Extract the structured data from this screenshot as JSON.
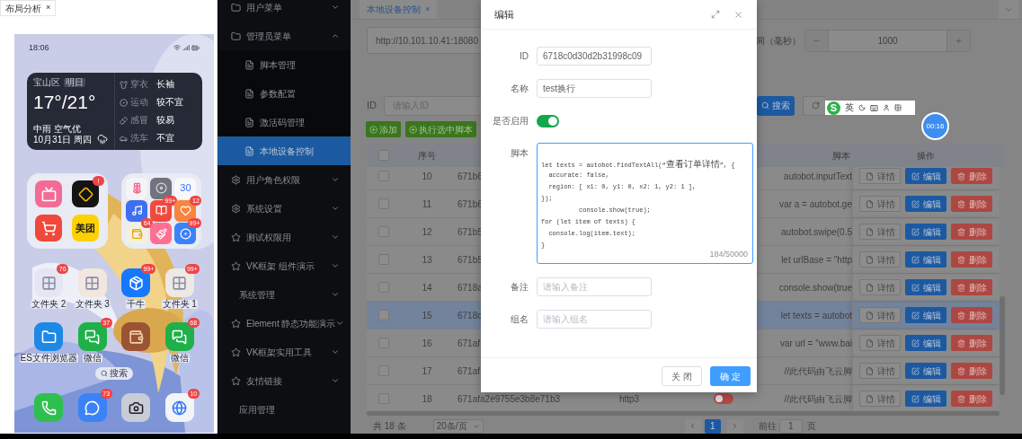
{
  "phone_panel": {
    "tab": {
      "label": "布局分析",
      "close": "×"
    },
    "time": "18:06",
    "weather": {
      "district": "宝山区",
      "day": "明日",
      "temperature": "17°/21°",
      "condition": "中雨 空气优",
      "date": "10月31日 周四",
      "indices": [
        {
          "kind": "clothes",
          "label": "穿衣",
          "value": "长袖"
        },
        {
          "kind": "sport",
          "label": "运动",
          "value": "较不宜"
        },
        {
          "kind": "cold",
          "label": "感冒",
          "value": "较易"
        },
        {
          "kind": "carwash",
          "label": "洗车",
          "value": "不宜"
        }
      ]
    },
    "folder_cards": [
      {
        "apps": [
          {
            "kind": "tv",
            "color": "#f46b96"
          },
          {
            "kind": "diamond",
            "color": "#141414",
            "badge": "!"
          },
          {
            "kind": "cart",
            "color": "#f0483a"
          },
          {
            "kind": "text",
            "color": "#ffd100",
            "text": "美团"
          }
        ]
      },
      {
        "apps": [
          {
            "kind": "flower",
            "color": "#f4f4f6"
          },
          {
            "kind": "wheel",
            "color": "#70747e"
          },
          {
            "kind": "calendar",
            "color": "#f8f8fa",
            "text": "30"
          },
          {
            "kind": "music",
            "color": "#3d6ff0"
          },
          {
            "kind": "book",
            "color": "#ee4b3e",
            "badge": "99+"
          },
          {
            "kind": "heart",
            "color": "#f8843d",
            "badge": "12"
          },
          {
            "kind": "wallet",
            "color": "#f4f0e0",
            "badge": "64"
          },
          {
            "kind": "brush",
            "color": "#ff6f91"
          },
          {
            "kind": "circle",
            "color": "#3b82f6",
            "badge": "99+"
          }
        ]
      }
    ],
    "home_rows": [
      [
        {
          "kind": "folder",
          "color": "#e4e7f3",
          "badge": "76",
          "label": "文件夹 2"
        },
        {
          "kind": "folder",
          "color": "#f1e7df",
          "label": "文件夹 3"
        },
        {
          "kind": "app",
          "color": "#1677ff",
          "badge": "99+",
          "label": "千牛"
        },
        {
          "kind": "folder",
          "color": "#eee9e4",
          "badge": "99+",
          "label": "文件夹 1"
        }
      ],
      [
        {
          "kind": "files",
          "color": "#1e88e5",
          "label": "ES文件浏览器"
        },
        {
          "kind": "chat",
          "color": "#1fb04a",
          "badge": "37",
          "label": "微信"
        },
        {
          "kind": "pouch",
          "color": "#9a5434"
        },
        {
          "kind": "chat",
          "color": "#1fb04a",
          "badge": "68",
          "label": "微信"
        }
      ]
    ],
    "search": "搜索",
    "dock": [
      {
        "kind": "phone",
        "color": "#2fbf4f"
      },
      {
        "kind": "message",
        "color": "#3b82f6",
        "badge": "73"
      },
      {
        "kind": "camera",
        "color": "#c9ccd6"
      },
      {
        "kind": "globe",
        "color": "#f2f4f8",
        "badge": "10"
      }
    ]
  },
  "sidebar": {
    "items": [
      {
        "kind": "folder",
        "label": "用户菜单",
        "expanded": false,
        "selected": false
      },
      {
        "kind": "folder",
        "label": "管理员菜单",
        "expanded": true,
        "selected": false,
        "children": [
          {
            "kind": "file",
            "label": "脚本管理",
            "selected": false
          },
          {
            "kind": "file",
            "label": "参数配置",
            "selected": false
          },
          {
            "kind": "file",
            "label": "激活码管理",
            "selected": false
          },
          {
            "kind": "file",
            "label": "本地设备控制",
            "selected": true
          }
        ]
      },
      {
        "kind": "gear",
        "label": "用户角色权限",
        "expanded": false,
        "selected": false
      },
      {
        "kind": "gear",
        "label": "系统设置",
        "expanded": false,
        "selected": false
      },
      {
        "kind": "star",
        "label": "测试权限用",
        "expanded": false,
        "selected": false
      },
      {
        "kind": "star",
        "label": "VK框架 组件演示",
        "expanded": false,
        "selected": false
      },
      {
        "label": "系统管理",
        "expanded": false,
        "selected": false
      },
      {
        "kind": "star",
        "label": "Element 静态功能演示",
        "expanded": false,
        "selected": false
      },
      {
        "kind": "star",
        "label": "VK框架实用工具",
        "expanded": false,
        "selected": false
      },
      {
        "kind": "star",
        "label": "友情链接",
        "expanded": false,
        "selected": false
      },
      {
        "label": "应用管理",
        "selected": false
      }
    ]
  },
  "tabs": [
    {
      "label": "本地设备控制",
      "close": "×",
      "selected": true
    }
  ],
  "url_field": {
    "value": "http://10.101.10.41:18080"
  },
  "interval": {
    "label": "间（毫秒）",
    "value": "1000"
  },
  "search_form": {
    "id_label": "ID",
    "id_placeholder": "请输入ID",
    "search_button": "搜索"
  },
  "toolbar": [
    {
      "label": "添加"
    },
    {
      "label": "执行选中脚本"
    }
  ],
  "table": {
    "header": {
      "checked": false,
      "index": "序号",
      "script": "脚本",
      "actions": "操作"
    },
    "rows": [
      {
        "checked": false,
        "selected": false,
        "index": "10",
        "id": "671b6",
        "script": "autobot.inputText",
        "actions": [
          {
            "kind": "detail",
            "label": "详情"
          },
          {
            "kind": "edit",
            "label": "编辑"
          },
          {
            "kind": "delete",
            "label": "删除"
          }
        ]
      },
      {
        "checked": false,
        "selected": false,
        "index": "11",
        "id": "671b6",
        "script": "var a = autobot.ge",
        "actions": [
          {
            "kind": "detail",
            "label": "详情"
          },
          {
            "kind": "edit",
            "label": "编辑"
          },
          {
            "kind": "delete",
            "label": "删除"
          }
        ]
      },
      {
        "checked": false,
        "selected": false,
        "index": "12",
        "id": "671b5",
        "script": "autobot.swipe(0.5",
        "actions": [
          {
            "kind": "detail",
            "label": "详情"
          },
          {
            "kind": "edit",
            "label": "编辑"
          },
          {
            "kind": "delete",
            "label": "删除"
          }
        ]
      },
      {
        "checked": false,
        "selected": false,
        "index": "13",
        "id": "671b5",
        "script": "let urlBase = \"http",
        "actions": [
          {
            "kind": "detail",
            "label": "详情"
          },
          {
            "kind": "edit",
            "label": "编辑"
          },
          {
            "kind": "delete",
            "label": "删除"
          }
        ]
      },
      {
        "checked": false,
        "selected": false,
        "index": "14",
        "id": "6718a",
        "script": "console.show(true",
        "actions": [
          {
            "kind": "detail",
            "label": "详情"
          },
          {
            "kind": "edit",
            "label": "编辑"
          },
          {
            "kind": "delete",
            "label": "删除"
          }
        ]
      },
      {
        "checked": false,
        "selected": true,
        "index": "15",
        "id": "6718c",
        "script": "let texts = autobot",
        "actions": [
          {
            "kind": "detail",
            "label": "详情"
          },
          {
            "kind": "edit",
            "label": "编辑"
          },
          {
            "kind": "delete",
            "label": "删除"
          }
        ]
      },
      {
        "checked": false,
        "selected": false,
        "index": "16",
        "id": "671af",
        "script": "var url = \"www.bai",
        "actions": [
          {
            "kind": "detail",
            "label": "详情"
          },
          {
            "kind": "edit",
            "label": "编辑"
          },
          {
            "kind": "delete",
            "label": "删除"
          }
        ]
      },
      {
        "checked": false,
        "selected": false,
        "index": "17",
        "id": "671af",
        "script": "//此代码由飞云脚",
        "actions": [
          {
            "kind": "detail",
            "label": "详情"
          },
          {
            "kind": "edit",
            "label": "编辑"
          },
          {
            "kind": "delete",
            "label": "删除"
          }
        ]
      },
      {
        "checked": false,
        "selected": false,
        "index": "18",
        "id": "671afa2e9755e3b8e71b3",
        "name": "http3",
        "enabled": false,
        "script": "//此代码由飞云脚",
        "actions": [
          {
            "kind": "detail",
            "label": "详情"
          },
          {
            "kind": "edit",
            "label": "编辑"
          },
          {
            "kind": "delete",
            "label": "删除"
          }
        ]
      }
    ]
  },
  "pagination": {
    "total": "共 18 条",
    "page_size": "20条/页",
    "pages": [
      {
        "label": "1",
        "selected": true
      }
    ],
    "goto_label": "前往",
    "goto_value": "1",
    "goto_suffix": "页"
  },
  "ime_toolbar": {
    "logo": "S",
    "mode": "英"
  },
  "recording_timer": "00:16",
  "dialog": {
    "title": "编辑",
    "fields": [
      {
        "kind": "input",
        "label": "ID",
        "value": "6718c0d30d2b31998c09"
      },
      {
        "kind": "input",
        "label": "名称",
        "value": "test换行"
      },
      {
        "kind": "switch",
        "label": "是否启用",
        "on": true
      },
      {
        "kind": "code",
        "label": "脚本",
        "counter": "184/50000",
        "lines": [
          "let texts = autobot.findTextAll(“查看订单详情”, {",
          "  accurate: false,",
          "  region: [ x1: 0, y1: 0, x2: 1, y2: 1 ],",
          "});",
          "          console.show(true);",
          "for (let item of texts) {",
          "  console.log(item.text);",
          "}"
        ]
      },
      {
        "kind": "input",
        "label": "备注",
        "placeholder": "请输入备注"
      },
      {
        "kind": "input",
        "label": "组名",
        "placeholder": "请输入组名"
      }
    ],
    "buttons": [
      {
        "kind": "secondary",
        "label": "关 闭"
      },
      {
        "kind": "primary",
        "label": "确 定"
      }
    ]
  }
}
